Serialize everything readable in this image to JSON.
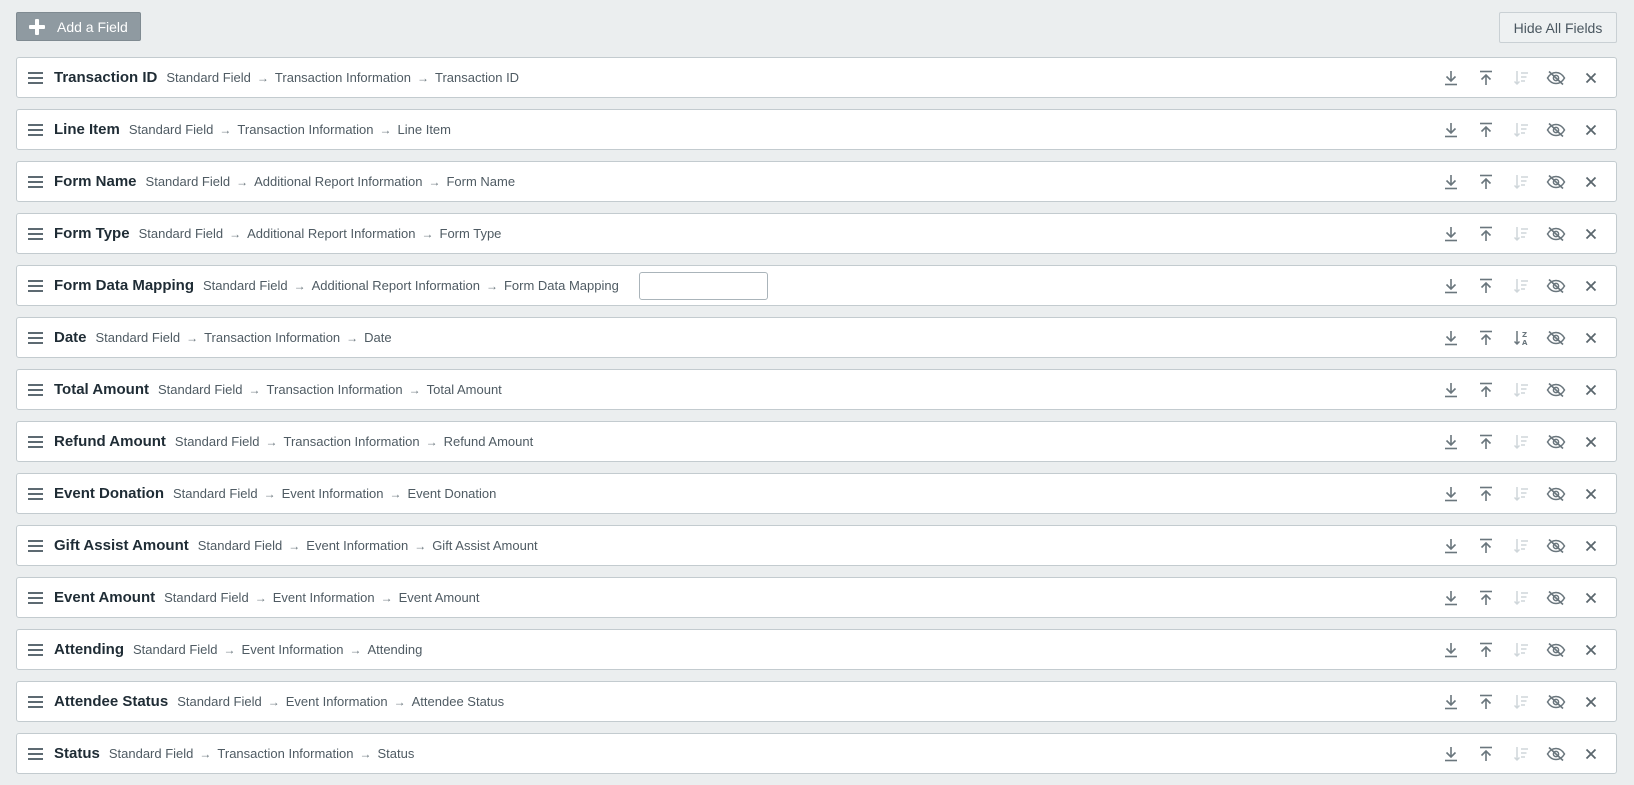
{
  "toolbar": {
    "add_field_label": "Add a Field",
    "hide_all_label": "Hide All Fields"
  },
  "colors": {
    "icon_active": "#6a767d",
    "icon_disabled": "#cfd6da",
    "button_gray": "#8f9aa1"
  },
  "fields": [
    {
      "name": "Transaction ID",
      "path": [
        "Standard Field",
        "Transaction Information",
        "Transaction ID"
      ],
      "sort_active": false,
      "has_input": false
    },
    {
      "name": "Line Item",
      "path": [
        "Standard Field",
        "Transaction Information",
        "Line Item"
      ],
      "sort_active": false,
      "has_input": false
    },
    {
      "name": "Form Name",
      "path": [
        "Standard Field",
        "Additional Report Information",
        "Form Name"
      ],
      "sort_active": false,
      "has_input": false
    },
    {
      "name": "Form Type",
      "path": [
        "Standard Field",
        "Additional Report Information",
        "Form Type"
      ],
      "sort_active": false,
      "has_input": false
    },
    {
      "name": "Form Data Mapping",
      "path": [
        "Standard Field",
        "Additional Report Information",
        "Form Data Mapping"
      ],
      "sort_active": false,
      "has_input": true,
      "input_value": ""
    },
    {
      "name": "Date",
      "path": [
        "Standard Field",
        "Transaction Information",
        "Date"
      ],
      "sort_active": true,
      "has_input": false
    },
    {
      "name": "Total Amount",
      "path": [
        "Standard Field",
        "Transaction Information",
        "Total Amount"
      ],
      "sort_active": false,
      "has_input": false
    },
    {
      "name": "Refund Amount",
      "path": [
        "Standard Field",
        "Transaction Information",
        "Refund Amount"
      ],
      "sort_active": false,
      "has_input": false
    },
    {
      "name": "Event Donation",
      "path": [
        "Standard Field",
        "Event Information",
        "Event Donation"
      ],
      "sort_active": false,
      "has_input": false
    },
    {
      "name": "Gift Assist Amount",
      "path": [
        "Standard Field",
        "Event Information",
        "Gift Assist Amount"
      ],
      "sort_active": false,
      "has_input": false
    },
    {
      "name": "Event Amount",
      "path": [
        "Standard Field",
        "Event Information",
        "Event Amount"
      ],
      "sort_active": false,
      "has_input": false
    },
    {
      "name": "Attending",
      "path": [
        "Standard Field",
        "Event Information",
        "Attending"
      ],
      "sort_active": false,
      "has_input": false
    },
    {
      "name": "Attendee Status",
      "path": [
        "Standard Field",
        "Event Information",
        "Attendee Status"
      ],
      "sort_active": false,
      "has_input": false
    },
    {
      "name": "Status",
      "path": [
        "Standard Field",
        "Transaction Information",
        "Status"
      ],
      "sort_active": false,
      "has_input": false
    }
  ]
}
